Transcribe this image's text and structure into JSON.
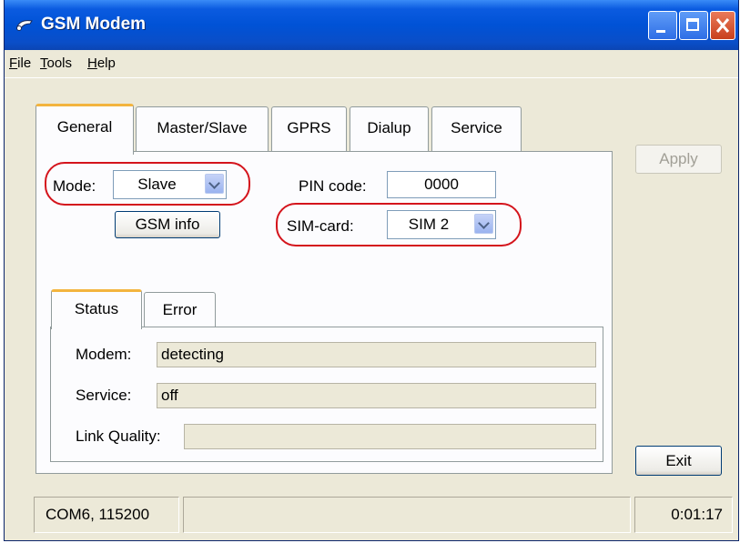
{
  "window": {
    "title": "GSM Modem"
  },
  "menu": [
    {
      "label": "File",
      "u": "F",
      "rest": "ile"
    },
    {
      "label": "Tools",
      "u": "T",
      "rest": "ools"
    },
    {
      "label": "Help",
      "u": "H",
      "rest": "elp"
    }
  ],
  "tabs": [
    "General",
    "Master/Slave",
    "GPRS",
    "Dialup",
    "Service"
  ],
  "general": {
    "mode_label": "Mode:",
    "mode_value": "Slave",
    "gsm_info_button": "GSM info",
    "pin_label": "PIN code:",
    "pin_value": "0000",
    "sim_label": "SIM-card:",
    "sim_value": "SIM 2"
  },
  "subtabs": [
    "Status",
    "Error"
  ],
  "status": {
    "modem_label": "Modem:",
    "modem_value": "detecting",
    "service_label": "Service:",
    "service_value": "off",
    "link_label": "Link Quality:",
    "link_value": ""
  },
  "buttons": {
    "apply": "Apply",
    "exit": "Exit"
  },
  "statusbar": {
    "port": "COM6, 115200",
    "middle": "",
    "time": "0:01:17"
  },
  "colors": {
    "highlight_oval": "#d4141c",
    "active_tab_accent": "#f3b43e",
    "titlebar": "#0052d6"
  }
}
